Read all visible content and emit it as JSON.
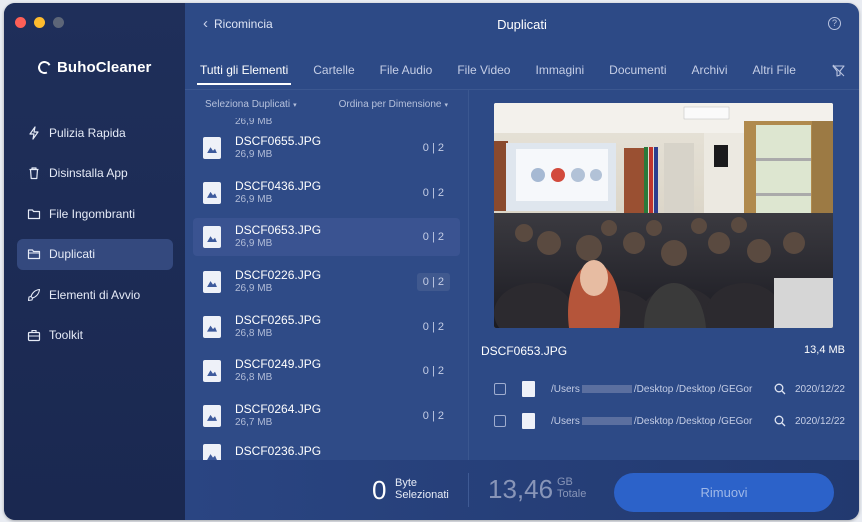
{
  "window": {
    "traffic_lights": [
      "close",
      "minimize",
      "zoom"
    ]
  },
  "brand": {
    "name": "BuhoCleaner"
  },
  "sidebar": {
    "items": [
      {
        "label": "Pulizia Rapida",
        "icon": "lightning-icon"
      },
      {
        "label": "Disinstalla App",
        "icon": "trash-icon"
      },
      {
        "label": "File Ingombranti",
        "icon": "folder-icon"
      },
      {
        "label": "Duplicati",
        "icon": "folder-icon",
        "active": true
      },
      {
        "label": "Elementi di Avvio",
        "icon": "rocket-icon"
      },
      {
        "label": "Toolkit",
        "icon": "toolbox-icon"
      }
    ]
  },
  "topbar": {
    "back_label": "Ricomincia",
    "title": "Duplicati",
    "help": "?"
  },
  "tabs": [
    "Tutti gli Elementi",
    "Cartelle",
    "File Audio",
    "File Video",
    "Immagini",
    "Documenti",
    "Archivi",
    "Altri File"
  ],
  "list": {
    "select_label": "Seleziona Duplicati",
    "sort_label": "Ordina per Dimensione",
    "top_partial_size": "26,9 MB",
    "rows": [
      {
        "name": "DSCF0655.JPG",
        "size": "26,9 MB",
        "count": "0 | 2"
      },
      {
        "name": "DSCF0436.JPG",
        "size": "26,9 MB",
        "count": "0 | 2"
      },
      {
        "name": "DSCF0653.JPG",
        "size": "26,9 MB",
        "count": "0 | 2"
      },
      {
        "name": "DSCF0226.JPG",
        "size": "26,9 MB",
        "count": "0 | 2"
      },
      {
        "name": "DSCF0265.JPG",
        "size": "26,8 MB",
        "count": "0 | 2"
      },
      {
        "name": "DSCF0249.JPG",
        "size": "26,8 MB",
        "count": "0 | 2"
      },
      {
        "name": "DSCF0264.JPG",
        "size": "26,7 MB",
        "count": "0 | 2"
      }
    ],
    "bottom_partial_name": "DSCF0236.JPG"
  },
  "preview": {
    "file_name": "DSCF0653.JPG",
    "file_size": "13,4 MB",
    "paths": [
      {
        "prefix": "/Users",
        "suffix": "/Desktop /Desktop /GEGor",
        "date": "2020/12/22"
      },
      {
        "prefix": "/Users",
        "suffix": "/Desktop /Desktop /GEGor",
        "date": "2020/12/22"
      }
    ]
  },
  "footer": {
    "selected_value": "0",
    "selected_unit_line1": "Byte",
    "selected_unit_line2": "Selezionati",
    "total_value": "13,46",
    "total_unit_line1": "GB",
    "total_unit_line2": "Totale",
    "remove_label": "Rimuovi"
  },
  "colors": {
    "sidebar_bg": "#1f2f5a",
    "main_bg": "#2d4a86",
    "accent_button": "#2c62c9",
    "close": "#fe5f57",
    "minimize": "#febc2e"
  }
}
